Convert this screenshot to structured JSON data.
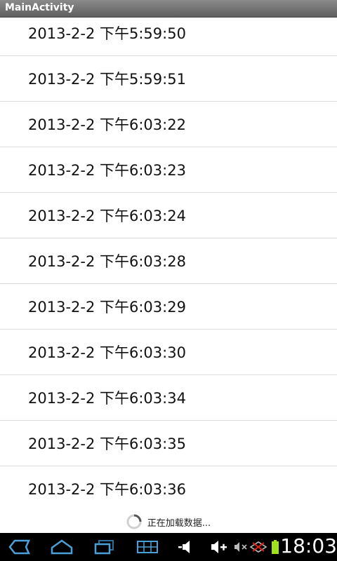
{
  "app": {
    "title": "MainActivity"
  },
  "list": {
    "items": [
      "2013-2-2 下午5:59:50",
      "2013-2-2 下午5:59:51",
      "2013-2-2 下午6:03:22",
      "2013-2-2 下午6:03:23",
      "2013-2-2 下午6:03:24",
      "2013-2-2 下午6:03:28",
      "2013-2-2 下午6:03:29",
      "2013-2-2 下午6:03:30",
      "2013-2-2 下午6:03:34",
      "2013-2-2 下午6:03:35",
      "2013-2-2 下午6:03:36"
    ]
  },
  "loading": {
    "text": "正在加载数据..."
  },
  "system_bar": {
    "time": "18:03",
    "icons": [
      "back-icon",
      "home-icon",
      "recent-apps-icon",
      "menu-icon",
      "volume-down-icon",
      "volume-up-icon",
      "mute-icon",
      "network-error-icon",
      "battery-icon"
    ]
  },
  "colors": {
    "titlebar": "#6e6e6e",
    "navbar": "#000000",
    "nav_icon": "#4aa0d8",
    "battery": "#9ee11c",
    "divider": "#dcdcdc"
  }
}
